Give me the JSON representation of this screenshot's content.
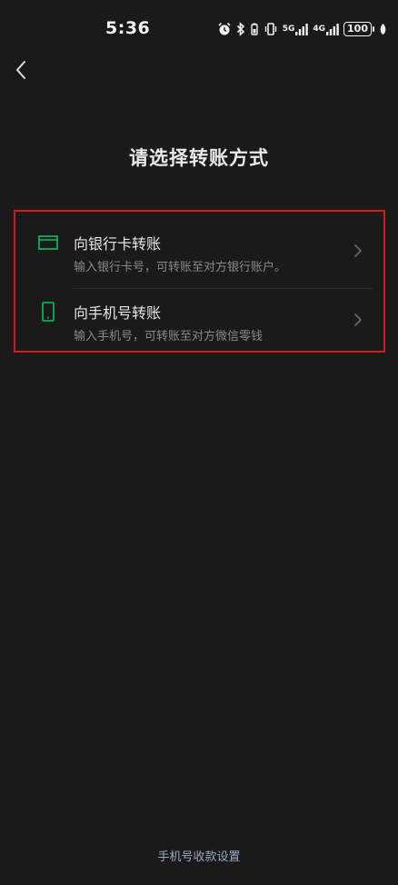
{
  "status_bar": {
    "time": "5:36",
    "net1": "5G",
    "net2": "4G",
    "battery": "100"
  },
  "page": {
    "title": "请选择转账方式"
  },
  "options": [
    {
      "title": "向银行卡转账",
      "description": "输入银行卡号，可转账至对方银行账户。",
      "icon": "bank-card-icon"
    },
    {
      "title": "向手机号转账",
      "description": "输入手机号，可转账至对方微信零钱",
      "icon": "mobile-phone-icon"
    }
  ],
  "footer": {
    "link_label": "手机号收款设置"
  },
  "colors": {
    "background": "#1a1a1a",
    "accent_green": "#07c160",
    "highlight_border": "#d01c1c",
    "footer_link": "#9aa7bf"
  }
}
